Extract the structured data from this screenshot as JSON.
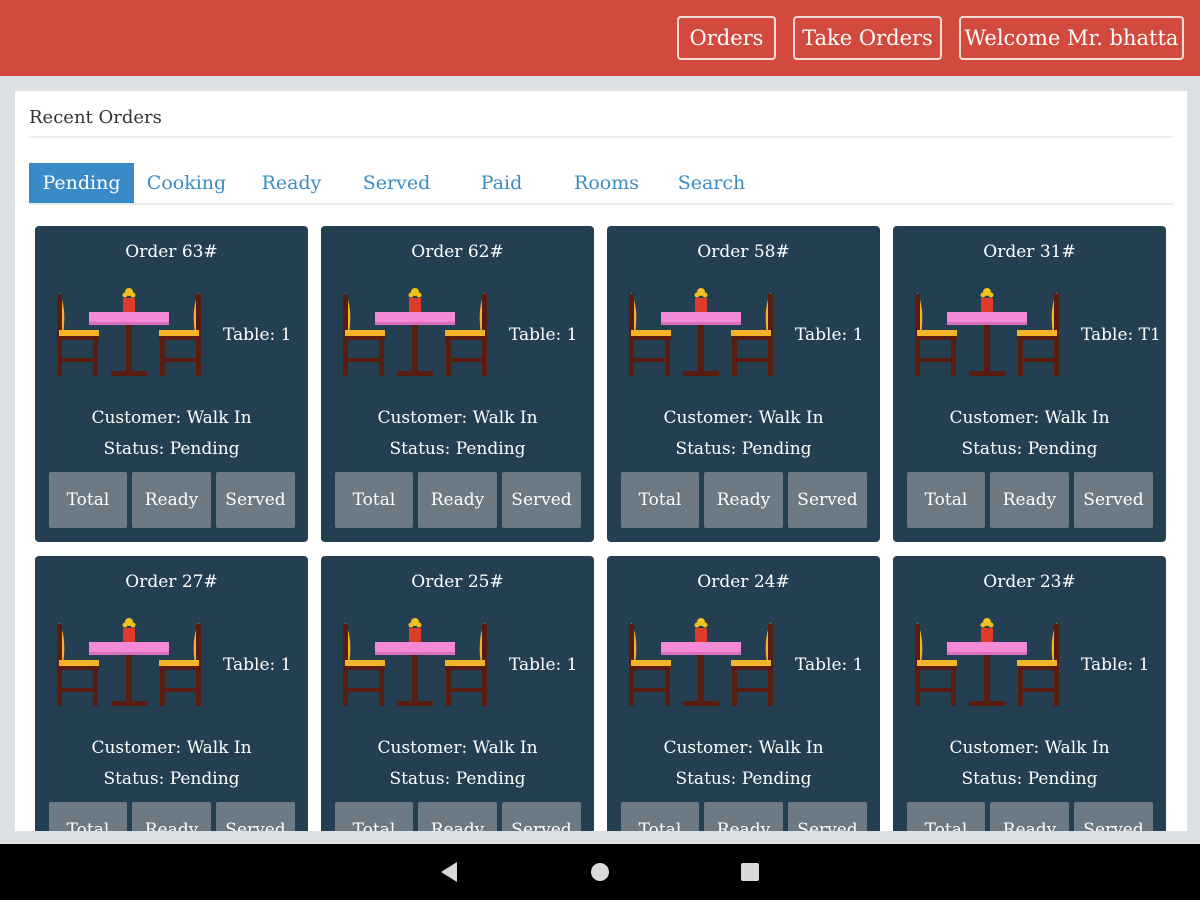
{
  "header": {
    "orders_label": "Orders",
    "take_orders_label": "Take Orders",
    "welcome_label": "Welcome Mr. bhatta"
  },
  "panel": {
    "title": "Recent Orders",
    "tabs": [
      {
        "label": "Pending",
        "active": true
      },
      {
        "label": "Cooking",
        "active": false
      },
      {
        "label": "Ready",
        "active": false
      },
      {
        "label": "Served",
        "active": false
      },
      {
        "label": "Paid",
        "active": false
      },
      {
        "label": "Rooms",
        "active": false
      },
      {
        "label": "Search",
        "active": false
      }
    ]
  },
  "orders": [
    {
      "title": "Order 63#",
      "table": "Table: 1",
      "customer": "Customer: Walk In",
      "status": "Status: Pending",
      "icon": "dining-table-icon"
    },
    {
      "title": "Order 62#",
      "table": "Table: 1",
      "customer": "Customer: Walk In",
      "status": "Status: Pending",
      "icon": "dining-table-icon"
    },
    {
      "title": "Order 58#",
      "table": "Table: 1",
      "customer": "Customer: Walk In",
      "status": "Status: Pending",
      "icon": "dining-table-icon"
    },
    {
      "title": "Order 31#",
      "table": "Table: T1",
      "customer": "Customer: Walk In",
      "status": "Status: Pending",
      "icon": "dining-table-icon"
    },
    {
      "title": "Order 27#",
      "table": "Table: 1",
      "customer": "Customer: Walk In",
      "status": "Status: Pending",
      "icon": "dining-table-icon"
    },
    {
      "title": "Order 25#",
      "table": "Table: 1",
      "customer": "Customer: Walk In",
      "status": "Status: Pending",
      "icon": "dining-table-icon"
    },
    {
      "title": "Order 24#",
      "table": "Table: 1",
      "customer": "Customer: Walk In",
      "status": "Status: Pending",
      "icon": "dining-table-icon"
    },
    {
      "title": "Order 23#",
      "table": "Table: 1",
      "customer": "Customer: Walk In",
      "status": "Status: Pending",
      "icon": "dining-table-icon"
    }
  ],
  "actions": {
    "total_label": "Total",
    "ready_label": "Ready",
    "served_label": "Served"
  },
  "colors": {
    "header_bg": "#d24a3e",
    "card_bg": "#243e52",
    "tab_active_bg": "#3a8ac7",
    "tab_text": "#3b8cc4",
    "action_btn_bg": "#6d7a83"
  },
  "navigation_bar": {
    "back_icon": "back-triangle-icon",
    "home_icon": "home-circle-icon",
    "recent_icon": "recent-apps-square-icon"
  }
}
